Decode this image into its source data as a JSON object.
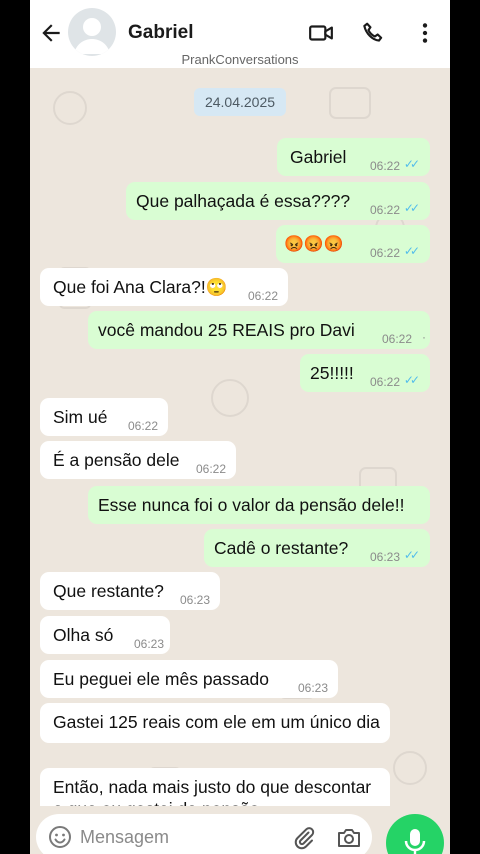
{
  "header": {
    "contact_name": "Gabriel",
    "icons": [
      "back-arrow-icon",
      "avatar",
      "video-call-icon",
      "phone-icon",
      "more-vert-icon"
    ]
  },
  "watermark": "PrankConversations",
  "date_chip": "24.04.2025",
  "messages": [
    {
      "dir": "out",
      "text": "Gabriel",
      "time": "06:22",
      "status": "read"
    },
    {
      "dir": "out",
      "text": "Que palhaçada é essa????",
      "time": "06:22",
      "status": "read"
    },
    {
      "dir": "out",
      "text": "😡😡😡",
      "time": "06:22",
      "status": "read"
    },
    {
      "dir": "in",
      "text": "Que foi Ana Clara?!🙄",
      "time": "06:22"
    },
    {
      "dir": "out",
      "text": "você mandou 25 REAIS pro Davi",
      "time": "06:22",
      "status": "pending"
    },
    {
      "dir": "out",
      "text": "25!!!!!",
      "time": "06:22",
      "status": "read"
    },
    {
      "dir": "in",
      "text": "Sim ué",
      "time": "06:22"
    },
    {
      "dir": "in",
      "text": "É a pensão dele",
      "time": "06:22"
    },
    {
      "dir": "out",
      "text": "Esse nunca foi o valor da pensão dele!!",
      "time": ""
    },
    {
      "dir": "out",
      "text": "Cadê o restante?",
      "time": "06:23",
      "status": "read"
    },
    {
      "dir": "in",
      "text": "Que restante?",
      "time": "06:23"
    },
    {
      "dir": "in",
      "text": "Olha só",
      "time": "06:23"
    },
    {
      "dir": "in",
      "text": "Eu peguei ele mês passado",
      "time": "06:23"
    },
    {
      "dir": "in",
      "text": "Gastei 125 reais com ele em um único dia",
      "time": ""
    },
    {
      "dir": "in",
      "text": "Então, nada mais justo do que descontar o que eu gastei da pensão",
      "time": ""
    }
  ],
  "composer": {
    "placeholder": "Mensagem",
    "icons": [
      "emoji-icon",
      "attach-icon",
      "camera-icon",
      "mic-icon"
    ]
  },
  "colors": {
    "outgoing_bubble": "#d9fdd3",
    "incoming_bubble": "#ffffff",
    "chat_background": "#ede6dd",
    "read_ticks": "#53bdeb",
    "mic_button": "#25d366"
  }
}
